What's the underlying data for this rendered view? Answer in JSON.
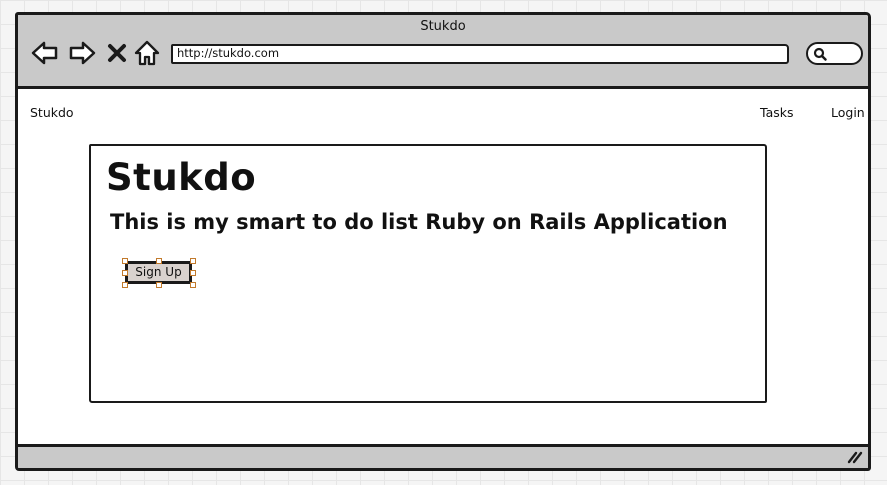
{
  "browser": {
    "title": "Stukdo",
    "url": "http://stukdo.com",
    "icons": {
      "back": "back-arrow-icon",
      "forward": "forward-arrow-icon",
      "stop": "stop-icon",
      "home": "home-icon",
      "search": "search-icon",
      "resize": "resize-grip-icon"
    }
  },
  "nav": {
    "brand": "Stukdo",
    "links": [
      {
        "label": "Tasks"
      },
      {
        "label": "Login"
      }
    ]
  },
  "hero": {
    "title": "Stukdo",
    "subtitle": "This is my smart to do list Ruby on Rails Application",
    "signup_label": "Sign Up"
  },
  "colors": {
    "chrome": "#c9c9c9",
    "border": "#1a1a1a",
    "button_fill": "#d9d2ce",
    "selection_handle": "#c27a2c"
  }
}
